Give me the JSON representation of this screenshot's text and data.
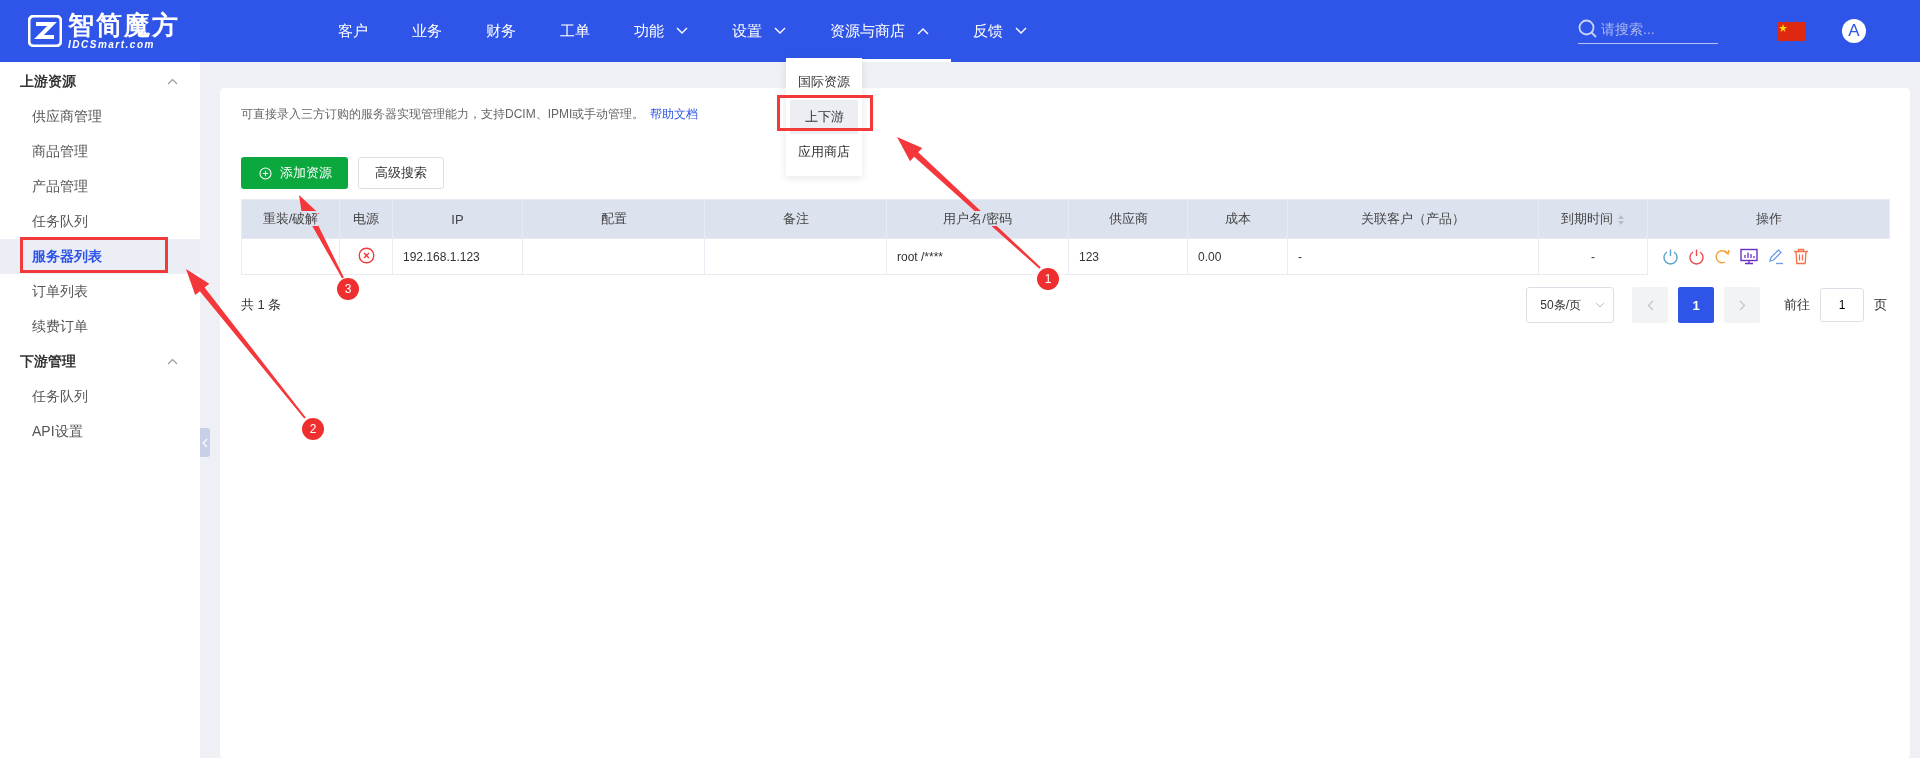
{
  "header": {
    "logo": {
      "name": "智简魔方",
      "domain": "IDCSmart.com"
    },
    "nav": [
      {
        "label": "客户",
        "has_menu": false,
        "selected": false
      },
      {
        "label": "业务",
        "has_menu": false,
        "selected": false
      },
      {
        "label": "财务",
        "has_menu": false,
        "selected": false
      },
      {
        "label": "工单",
        "has_menu": false,
        "selected": false
      },
      {
        "label": "功能",
        "has_menu": true,
        "selected": false
      },
      {
        "label": "设置",
        "has_menu": true,
        "selected": false
      },
      {
        "label": "资源与商店",
        "has_menu": true,
        "selected": true
      },
      {
        "label": "反馈",
        "has_menu": true,
        "selected": false
      }
    ],
    "search": {
      "placeholder": "请搜索..."
    },
    "avatar": "A"
  },
  "nav_menu": {
    "items": [
      {
        "label": "国际资源",
        "selected": false
      },
      {
        "label": "上下游",
        "selected": true
      },
      {
        "label": "应用商店",
        "selected": false
      }
    ]
  },
  "sidebar": {
    "groups": [
      {
        "title": "上游资源",
        "expanded": true,
        "items": [
          {
            "label": "供应商管理",
            "selected": false
          },
          {
            "label": "商品管理",
            "selected": false
          },
          {
            "label": "产品管理",
            "selected": false
          },
          {
            "label": "任务队列",
            "selected": false
          },
          {
            "label": "服务器列表",
            "selected": true
          },
          {
            "label": "订单列表",
            "selected": false
          },
          {
            "label": "续费订单",
            "selected": false
          }
        ]
      },
      {
        "title": "下游管理",
        "expanded": true,
        "items": [
          {
            "label": "任务队列",
            "selected": false
          },
          {
            "label": "API设置",
            "selected": false
          }
        ]
      }
    ]
  },
  "content": {
    "description": "可直接录入三方订购的服务器实现管理能力，支持DCIM、IPMI或手动管理。",
    "help_link": "帮助文档",
    "buttons": [
      {
        "label": "添加资源",
        "kind": "primary"
      },
      {
        "label": "高级搜索",
        "kind": "plain"
      }
    ],
    "table": {
      "columns": [
        {
          "label": "重装/破解",
          "sortable": false
        },
        {
          "label": "电源",
          "sortable": false
        },
        {
          "label": "IP",
          "sortable": false
        },
        {
          "label": "配置",
          "sortable": false
        },
        {
          "label": "备注",
          "sortable": false
        },
        {
          "label": "用户名/密码",
          "sortable": false
        },
        {
          "label": "供应商",
          "sortable": false
        },
        {
          "label": "成本",
          "sortable": false
        },
        {
          "label": "关联客户（产品）",
          "sortable": false
        },
        {
          "label": "到期时间",
          "sortable": true
        },
        {
          "label": "操作",
          "sortable": false
        }
      ],
      "rows": [
        {
          "power_on": false,
          "ip": "192.168.1.123",
          "config": "",
          "note": "",
          "credentials": "root /****",
          "supplier": "123",
          "cost": "0.00",
          "customer": "-",
          "expires": "-"
        }
      ]
    },
    "pagination": {
      "total": "共 1 条",
      "page_size": "50条/页",
      "pages": [
        {
          "label": "1",
          "selected": true
        }
      ],
      "goto_label": "前往",
      "goto_value": "1",
      "goto_suffix": "页"
    }
  },
  "annotations": [
    {
      "number": "1"
    },
    {
      "number": "2"
    },
    {
      "number": "3"
    }
  ]
}
